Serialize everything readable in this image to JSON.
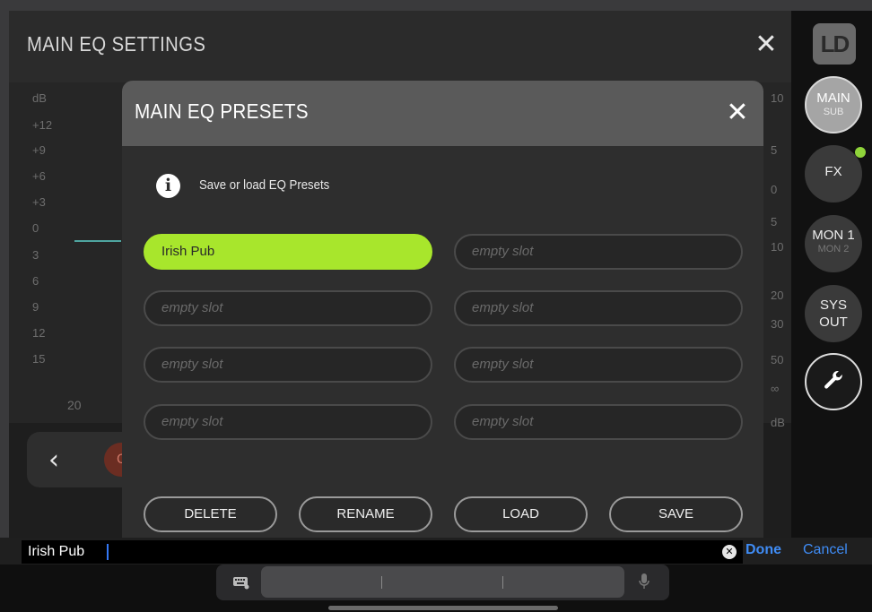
{
  "app": {
    "title": "MAIN EQ SETTINGS",
    "close_symbol": "✕",
    "graph": {
      "db_labels": [
        "dB",
        "+12",
        "+9",
        "+6",
        "+3",
        "0",
        "3",
        "6",
        "9",
        "12",
        "15"
      ],
      "right_labels": [
        "10",
        "5",
        "0",
        "5",
        "10",
        "20",
        "30",
        "50",
        "∞",
        "dB"
      ],
      "freq_label": "20"
    },
    "back_symbol": "‹",
    "on_label": "ON"
  },
  "sidebar": {
    "logo": "LD",
    "main": {
      "line1": "MAIN",
      "line2": "SUB"
    },
    "fx": {
      "line1": "FX"
    },
    "mon": {
      "line1": "MON 1",
      "line2": "MON 2"
    },
    "sys": {
      "line1": "SYS",
      "line2": "OUT"
    },
    "tool_icon": "wrench-icon",
    "fx_indicator_color": "#8fd43a"
  },
  "modal": {
    "title": "MAIN EQ PRESETS",
    "close_symbol": "✕",
    "info_symbol": "i",
    "info_text": "Save or load EQ Presets",
    "slots": [
      "Irish Pub",
      "empty slot",
      "empty slot",
      "empty slot",
      "empty slot",
      "empty slot",
      "empty slot",
      "empty slot"
    ],
    "selected_slot_color": "#a8e62c",
    "actions": {
      "delete": "DELETE",
      "rename": "RENAME",
      "load": "LOAD",
      "save": "SAVE"
    }
  },
  "input_bar": {
    "value": "Irish Pub",
    "clear_symbol": "✕",
    "done": "Done",
    "cancel": "Cancel",
    "accent_color": "#3f8cf5"
  },
  "keyboard": {
    "keyboard_icon": "keyboard-icon",
    "mic_icon": "microphone-icon"
  }
}
